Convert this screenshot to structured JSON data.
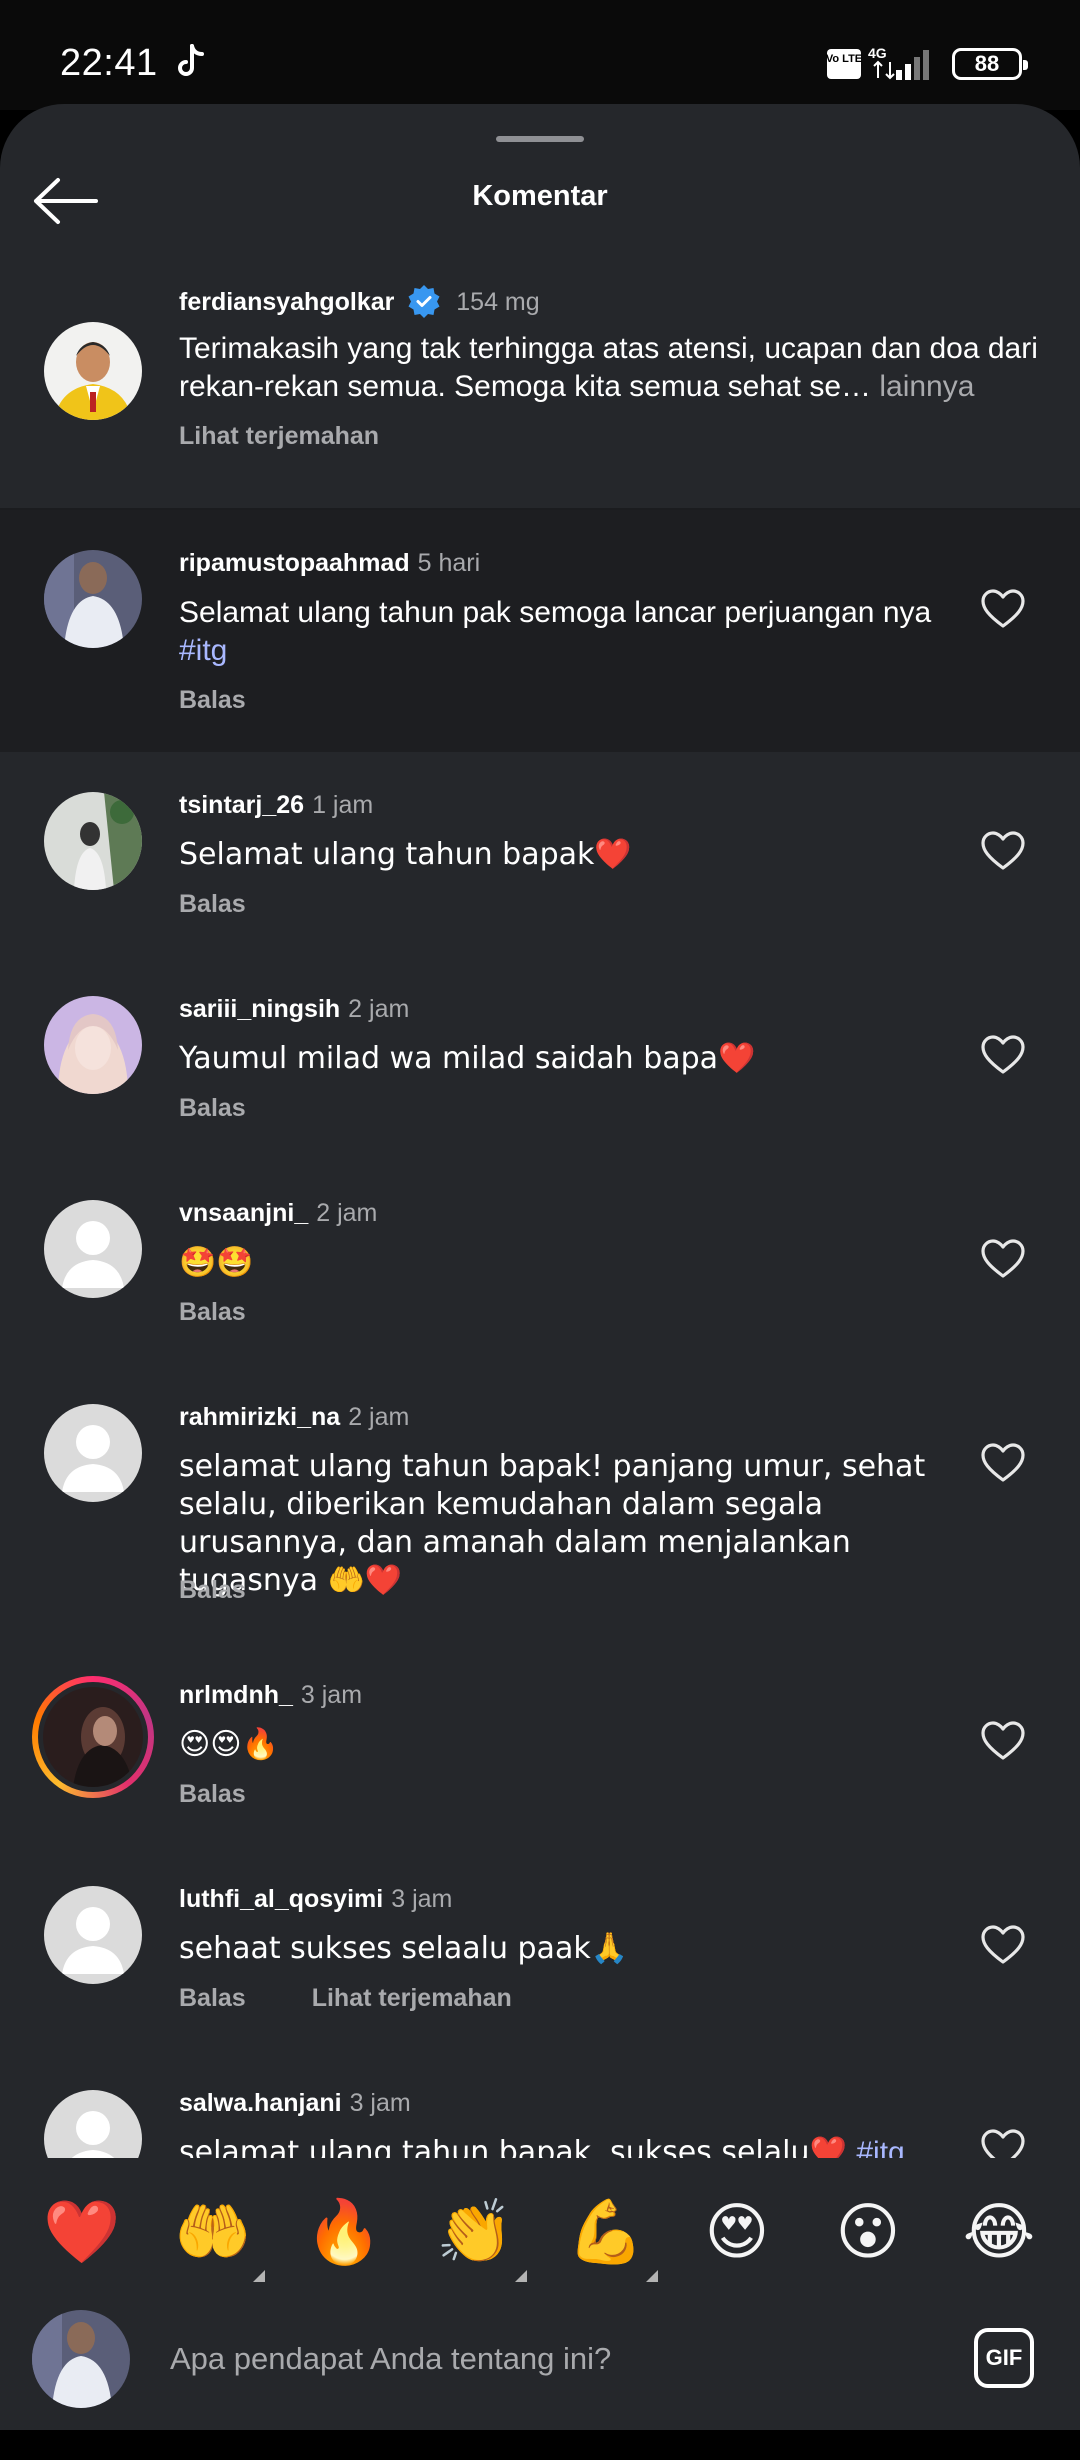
{
  "status_bar": {
    "time": "22:41",
    "network": "4G",
    "volte": "Vo LTE",
    "battery": "88"
  },
  "header": {
    "title": "Komentar"
  },
  "caption": {
    "username": "ferdiansyahgolkar",
    "time": "154 mg",
    "text": "Terimakasih yang tak terhingga atas atensi, ucapan dan doa dari rekan-rekan semua. Semoga kita semua sehat se…",
    "more": " lainnya",
    "translate": "Lihat terjemahan"
  },
  "comments": [
    {
      "username": "ripamustopaahmad",
      "time": "5 hari",
      "text": "Selamat ulang tahun pak semoga lancar perjuangan nya ",
      "hashtag": "#itg",
      "reply": "Balas"
    },
    {
      "username": "tsintarj_26",
      "time": "1 jam",
      "text": "Selamat ulang tahun bapak❤️",
      "reply": "Balas"
    },
    {
      "username": "sariii_ningsih",
      "time": "2 jam",
      "text": "Yaumul milad wa milad saidah bapa❤️",
      "reply": "Balas"
    },
    {
      "username": "vnsaanjni_",
      "time": "2 jam",
      "text": "🤩🤩",
      "reply": "Balas"
    },
    {
      "username": "rahmirizki_na",
      "time": "2 jam",
      "text": "selamat ulang tahun bapak! panjang umur, sehat selalu, diberikan kemudahan dalam segala urusannya, dan amanah dalam menjalankan tugasnya 🤲❤️",
      "reply": "Balas"
    },
    {
      "username": "nrlmdnh_",
      "time": "3 jam",
      "text": "😍😍🔥",
      "reply": "Balas"
    },
    {
      "username": "luthfi_al_qosyimi",
      "time": "3 jam",
      "text": "sehaat sukses selaalu paak🙏",
      "reply": "Balas",
      "translate": "Lihat terjemahan"
    },
    {
      "username": "salwa.hanjani",
      "time": "3 jam",
      "text": "selamat ulang tahun bapak, sukses selalu❤️ ",
      "hashtag": "#itg"
    }
  ],
  "quick_emojis": [
    "❤️",
    "🤲",
    "🔥",
    "👏",
    "💪",
    "😍",
    "😮",
    "😂"
  ],
  "composer": {
    "placeholder": "Apa pendapat Anda tentang ini?",
    "gif_label": "GIF"
  },
  "colors": {
    "sheet_bg": "#25272b",
    "highlight_bg": "#1d1e21",
    "hashtag": "#a9b8ff",
    "secondary_text": "#a9aaad",
    "verified": "#3897f0"
  }
}
